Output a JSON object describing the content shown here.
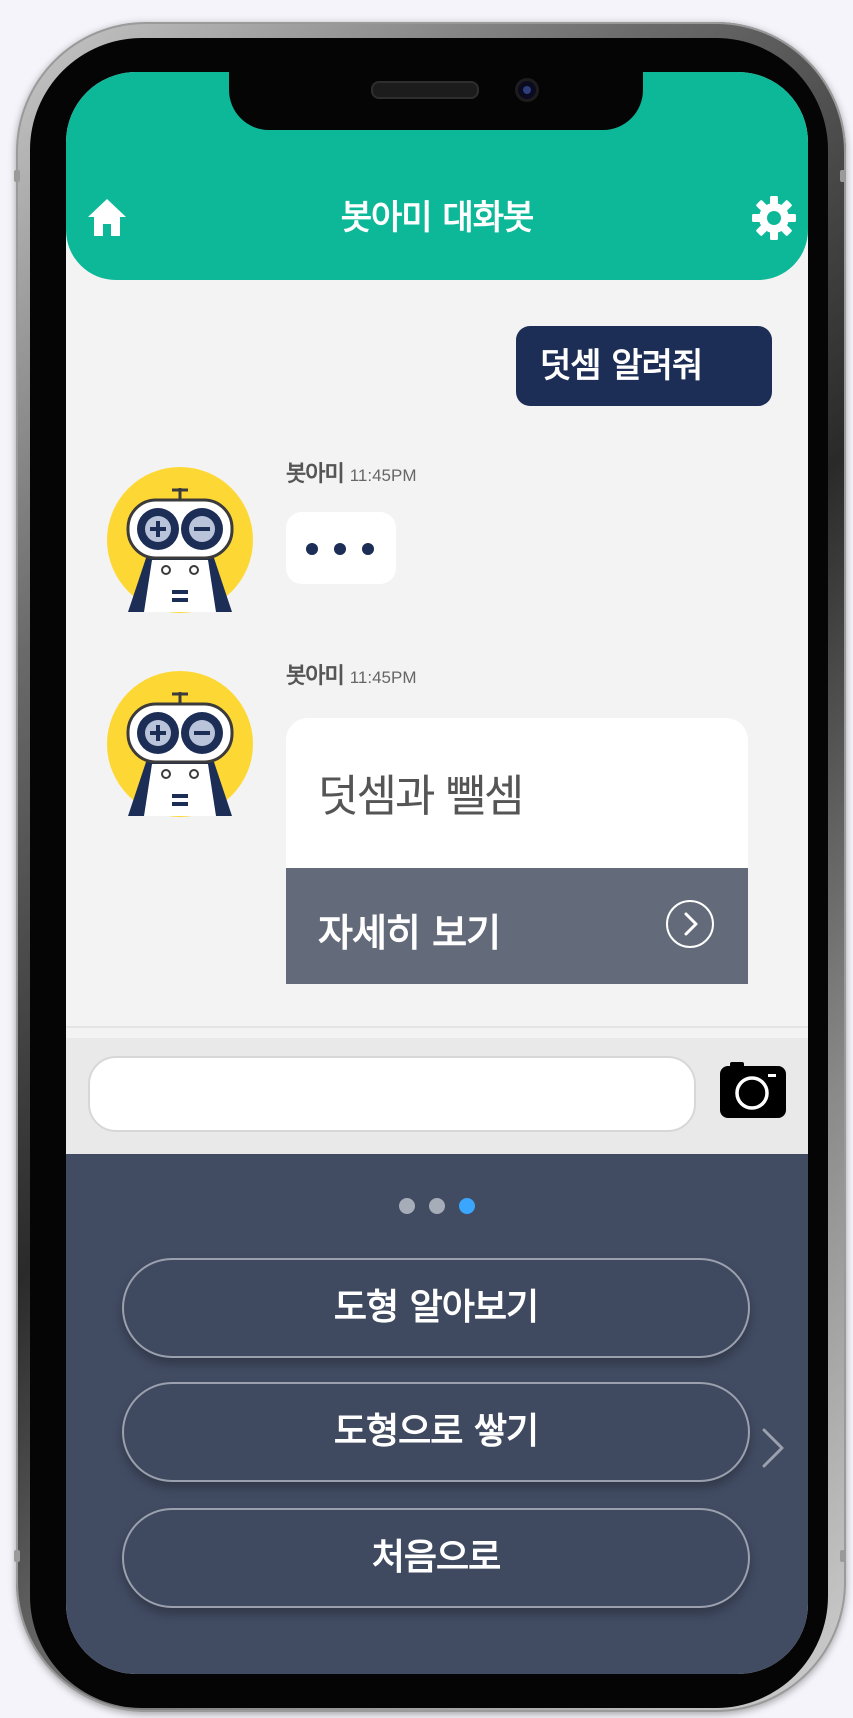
{
  "header": {
    "title": "봇아미 대화봇",
    "home_icon": "home-icon",
    "settings_icon": "gear-icon",
    "color": "#0db899"
  },
  "chat": {
    "user_message": "덧셈 알려줘",
    "bot_messages": [
      {
        "name": "봇아미",
        "time": "11:45PM",
        "type": "typing"
      },
      {
        "name": "봇아미",
        "time": "11:45PM",
        "type": "card",
        "card_title": "덧셈과 뺄셈",
        "card_action": "자세히 보기"
      }
    ]
  },
  "input": {
    "value": "",
    "placeholder": "",
    "camera_icon": "camera-icon"
  },
  "suggestions": {
    "page_count": 3,
    "active_page": 3,
    "items": [
      "도형 알아보기",
      "도형으로 쌓기",
      "처음으로"
    ],
    "next_icon": "chevron-right-icon"
  },
  "colors": {
    "accent": "#0db899",
    "user_bubble": "#1c2d56",
    "panel": "#414b62",
    "pager_active": "#3aa6ff"
  }
}
